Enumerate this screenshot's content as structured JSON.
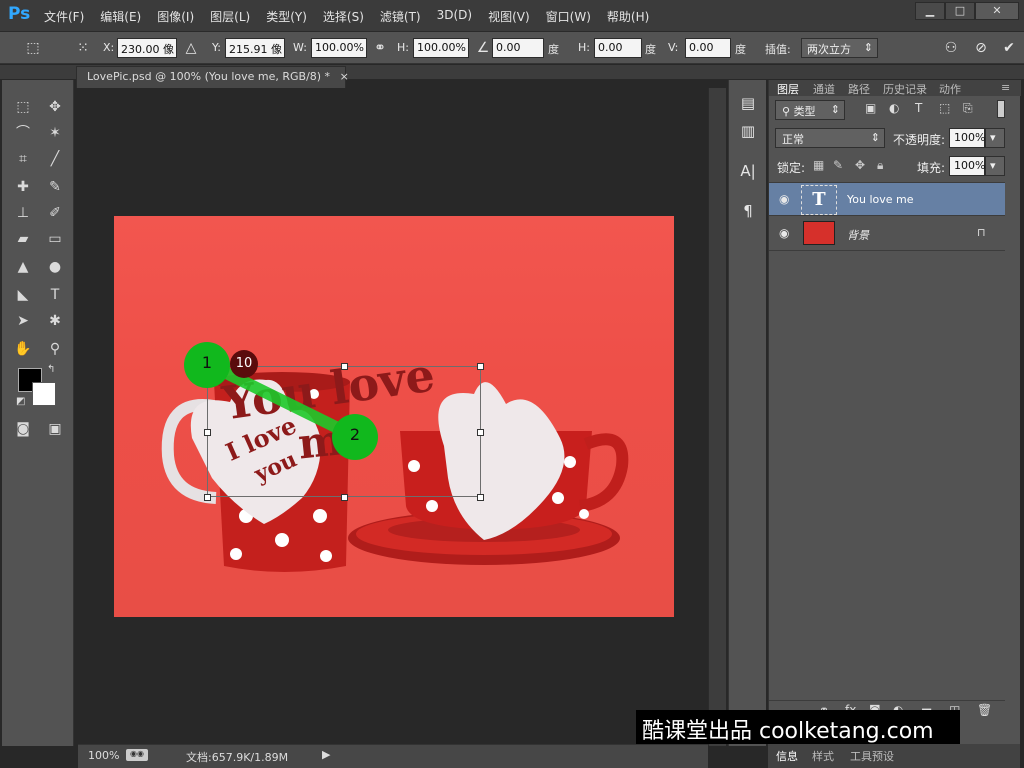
{
  "app": {
    "logo": "Ps"
  },
  "menu": [
    "文件(F)",
    "编辑(E)",
    "图像(I)",
    "图层(L)",
    "类型(Y)",
    "选择(S)",
    "滤镜(T)",
    "3D(D)",
    "视图(V)",
    "窗口(W)",
    "帮助(H)"
  ],
  "options": {
    "x_label": "X:",
    "x_value": "230.00 像",
    "y_label": "Y:",
    "y_value": "215.91 像",
    "w_label": "W:",
    "w_value": "100.00%",
    "h_label": "H:",
    "h_value": "100.00%",
    "angle_value": "0.00",
    "angle_unit": "度",
    "hskew_label": "H:",
    "hskew_value": "0.00",
    "hskew_unit": "度",
    "vskew_label": "V:",
    "vskew_value": "0.00",
    "vskew_unit": "度",
    "interp_label": "插值:",
    "interp_value": "两次立方"
  },
  "document": {
    "tab_title": "LovePic.psd @ 100% (You love me, RGB/8) *",
    "tab_close": "×"
  },
  "canvas": {
    "text_large": "You love",
    "text_me": "me",
    "text_small": "I love",
    "text_small2": "you",
    "marker_1": "1",
    "marker_2": "2",
    "marker_10": "10"
  },
  "status": {
    "zoom": "100%",
    "doc_info": "文档:657.9K/1.89M"
  },
  "layers_panel": {
    "tabs": [
      "图层",
      "通道",
      "路径",
      "历史记录",
      "动作"
    ],
    "filter_kind": "类型",
    "blend_mode": "正常",
    "opacity_label": "不透明度:",
    "opacity_value": "100%",
    "lock_label": "锁定:",
    "fill_label": "填充:",
    "fill_value": "100%",
    "layers": [
      {
        "name": "You love me",
        "type": "text",
        "selected": true
      },
      {
        "name": "背景",
        "type": "image",
        "selected": false,
        "locked": true
      }
    ]
  },
  "info_tabs": [
    "信息",
    "样式",
    "工具预设"
  ],
  "watermark": "酷课堂出品 coolketang.com",
  "colors": {
    "accent": "#31a8ff",
    "selected_layer": "#6680a4",
    "marker": "#11b81d"
  }
}
